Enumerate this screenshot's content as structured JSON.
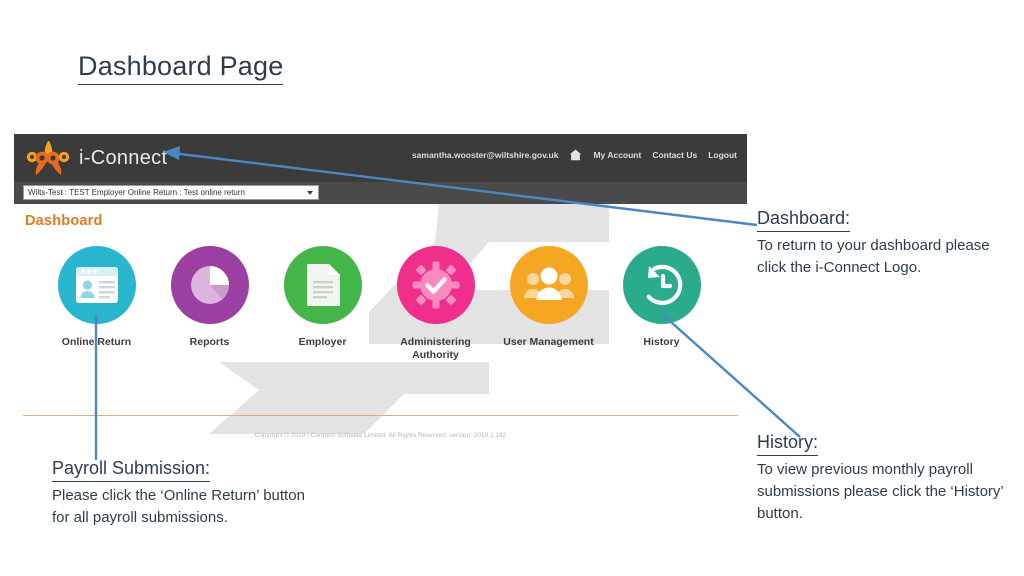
{
  "slide": {
    "title": "Dashboard Page"
  },
  "app": {
    "logo_text": "i-Connect",
    "logo_icon": "i-connect-molecule-logo",
    "header": {
      "user_email": "samantha.wooster@wiltshire.gov.uk",
      "home_icon": "home-icon",
      "links": [
        {
          "label": "My Account"
        },
        {
          "label": "Contact Us"
        },
        {
          "label": "Logout"
        }
      ]
    },
    "org_selector": {
      "value": "Wilts-Test : TEST Employer Online Return : Test online return",
      "caret_icon": "chevron-down-icon"
    },
    "page_heading": "Dashboard",
    "tiles": [
      {
        "label": "Online Return",
        "icon": "browser-id-card-icon",
        "color": "#28b5cd"
      },
      {
        "label": "Reports",
        "icon": "pie-chart-icon",
        "color": "#9b3fa2"
      },
      {
        "label": "Employer",
        "icon": "document-icon",
        "color": "#44b549"
      },
      {
        "label": "Administering Authority",
        "icon": "gear-check-icon",
        "color": "#ef2f8b"
      },
      {
        "label": "User Management",
        "icon": "users-group-icon",
        "color": "#f5a623"
      },
      {
        "label": "History",
        "icon": "history-clock-icon",
        "color": "#2aab8b"
      }
    ],
    "footer": "Copyright © 2019 i-Connect Software Limited. All Rights Reserved. version: 2019.1.182"
  },
  "annotations": [
    {
      "id": "dashboard",
      "title": "Dashboard:",
      "body": "To return to your dashboard please click the i-Connect Logo."
    },
    {
      "id": "history",
      "title": "History:",
      "body": "To view previous monthly payroll submissions please click the ‘History’ button."
    },
    {
      "id": "payroll",
      "title": "Payroll Submission:",
      "body": "Please click the ‘Online Return’ button for all payroll submissions."
    }
  ],
  "colors": {
    "annotation_line": "#4a87c4",
    "heading_orange": "#e07b20",
    "header_bar": "#3b3b3b",
    "subbar": "#4a4a4a",
    "footer_rule": "#e8a977",
    "text_dark": "#2e3d4c"
  }
}
